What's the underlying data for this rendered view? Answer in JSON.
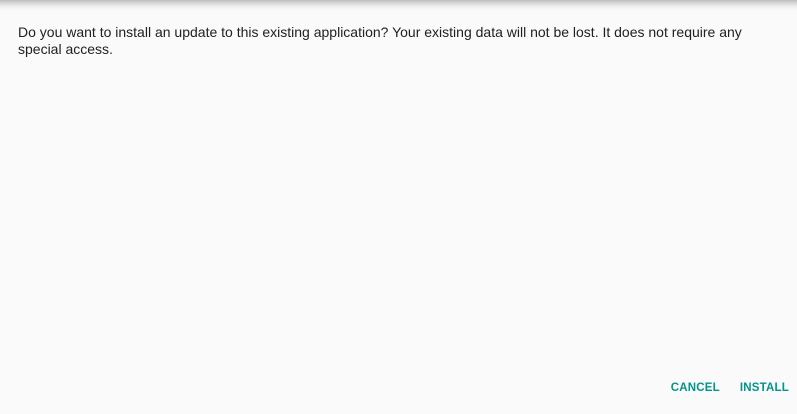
{
  "dialog": {
    "message": "Do you want to install an update to this existing application? Your existing data will not be lost. It does not require any special access.",
    "cancel_label": "CANCEL",
    "install_label": "INSTALL"
  },
  "colors": {
    "accent": "#009688",
    "text": "#212121",
    "background": "#fafafa"
  }
}
